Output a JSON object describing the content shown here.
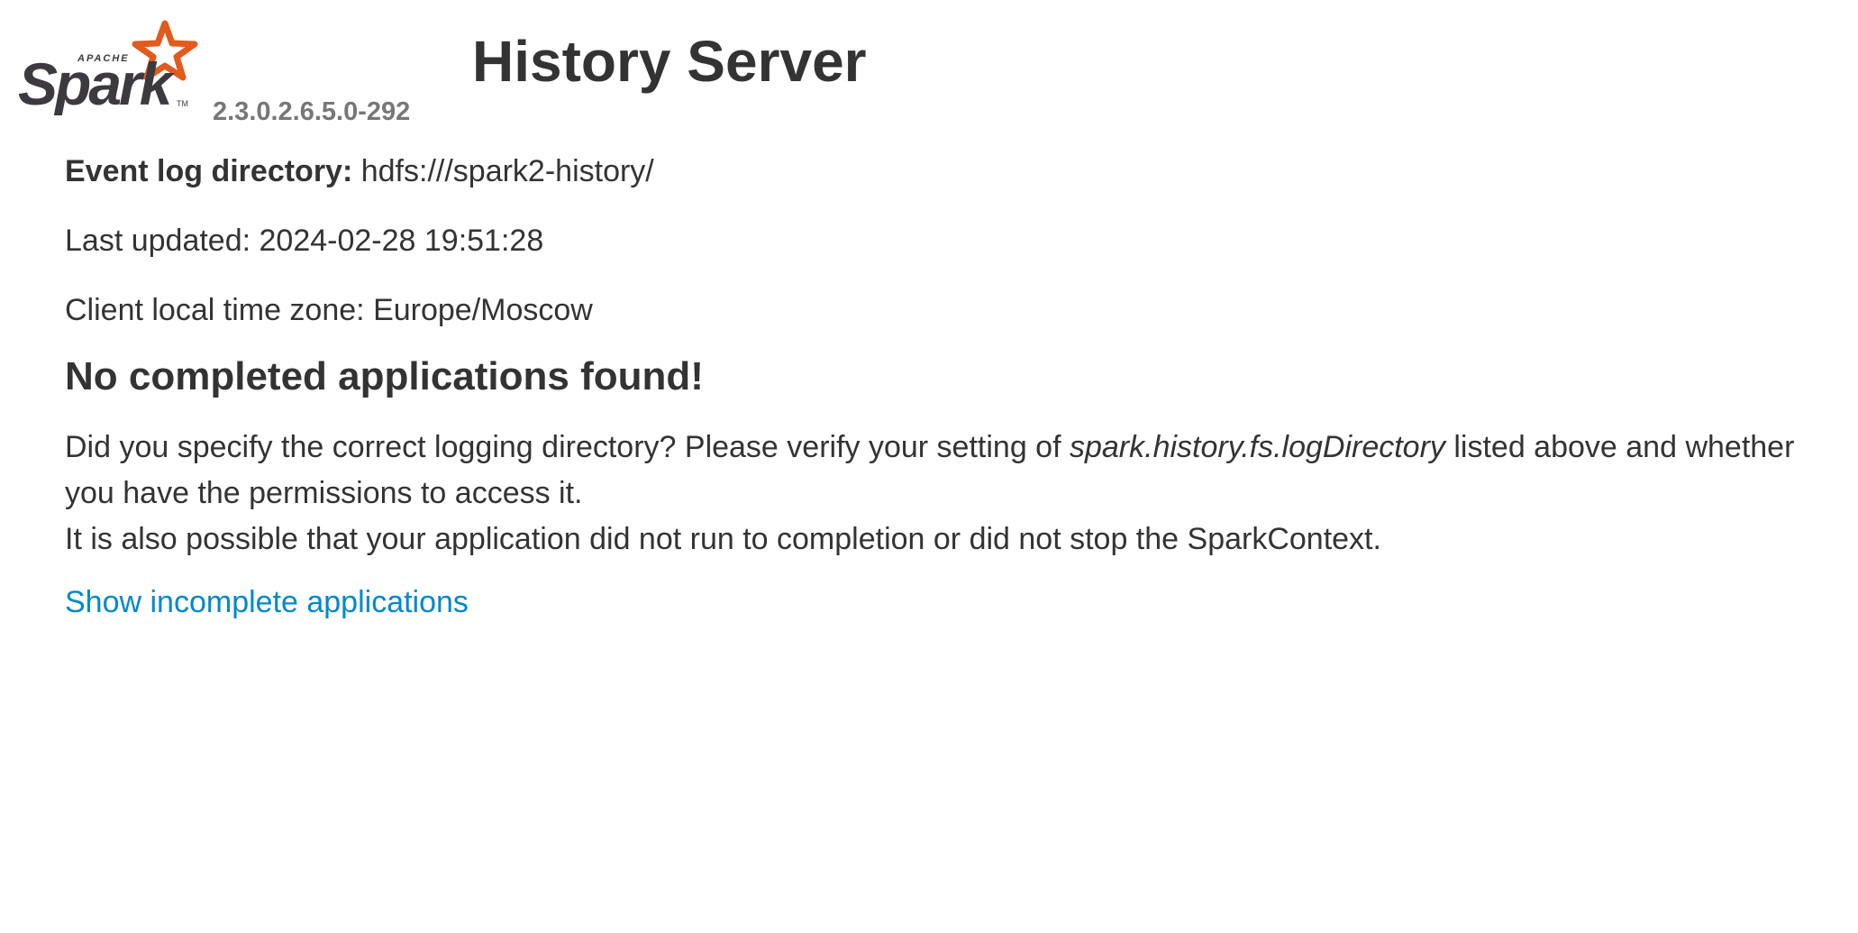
{
  "header": {
    "logo_alt": "Apache Spark",
    "logo_small_text": "APACHE",
    "logo_word": "Spark",
    "version": "2.3.0.2.6.5.0-292",
    "title": "History Server"
  },
  "info": {
    "event_log_label": "Event log directory:",
    "event_log_value": "hdfs:///spark2-history/",
    "last_updated_label": "Last updated:",
    "last_updated_value": "2024-02-28 19:51:28",
    "timezone_label": "Client local time zone:",
    "timezone_value": "Europe/Moscow"
  },
  "empty_state": {
    "heading": "No completed applications found!",
    "line1_before": "Did you specify the correct logging directory? Please verify your setting of ",
    "line1_italic": "spark.history.fs.logDirectory",
    "line1_after": " listed above and whether you have the permissions to access it.",
    "line2": "It is also possible that your application did not run to completion or did not stop the SparkContext."
  },
  "links": {
    "show_incomplete": "Show incomplete applications"
  },
  "colors": {
    "logo_star": "#e25a1c",
    "logo_text": "#3c3a3e",
    "link": "#0088cc",
    "version": "#777777",
    "text": "#333333"
  }
}
